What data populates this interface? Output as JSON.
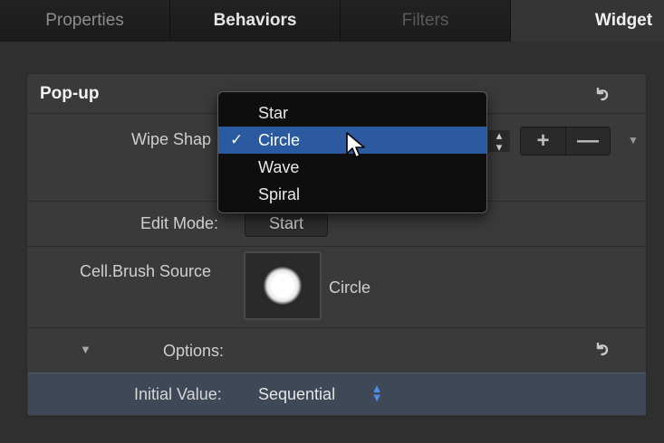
{
  "tabs": [
    {
      "label": "Properties"
    },
    {
      "label": "Behaviors"
    },
    {
      "label": "Filters"
    },
    {
      "label": "Widget"
    }
  ],
  "panel": {
    "title": "Pop-up",
    "wipe_shape_label": "Wipe Shap",
    "edit_mode_label": "Edit Mode:",
    "edit_mode_button": "Start",
    "cell_brush_label": "Cell.Brush Source",
    "cell_brush_value": "Circle",
    "options_label": "Options:",
    "initial_value_label": "Initial Value:",
    "initial_value": "Sequential",
    "plus_label": "+",
    "minus_label": "—"
  },
  "popup_menu": {
    "items": [
      {
        "label": "Star"
      },
      {
        "label": "Circle"
      },
      {
        "label": "Wave"
      },
      {
        "label": "Spiral"
      }
    ],
    "selected_check": "✓"
  },
  "icons": {
    "reset": "reset-arrow-icon",
    "disclosure": "disclosure-triangle-icon",
    "cursor": "mouse-pointer-icon"
  },
  "colors": {
    "selection": "#2b5aa0",
    "initial_row": "#3f4856",
    "stepper_accent": "#4d8fe8"
  }
}
